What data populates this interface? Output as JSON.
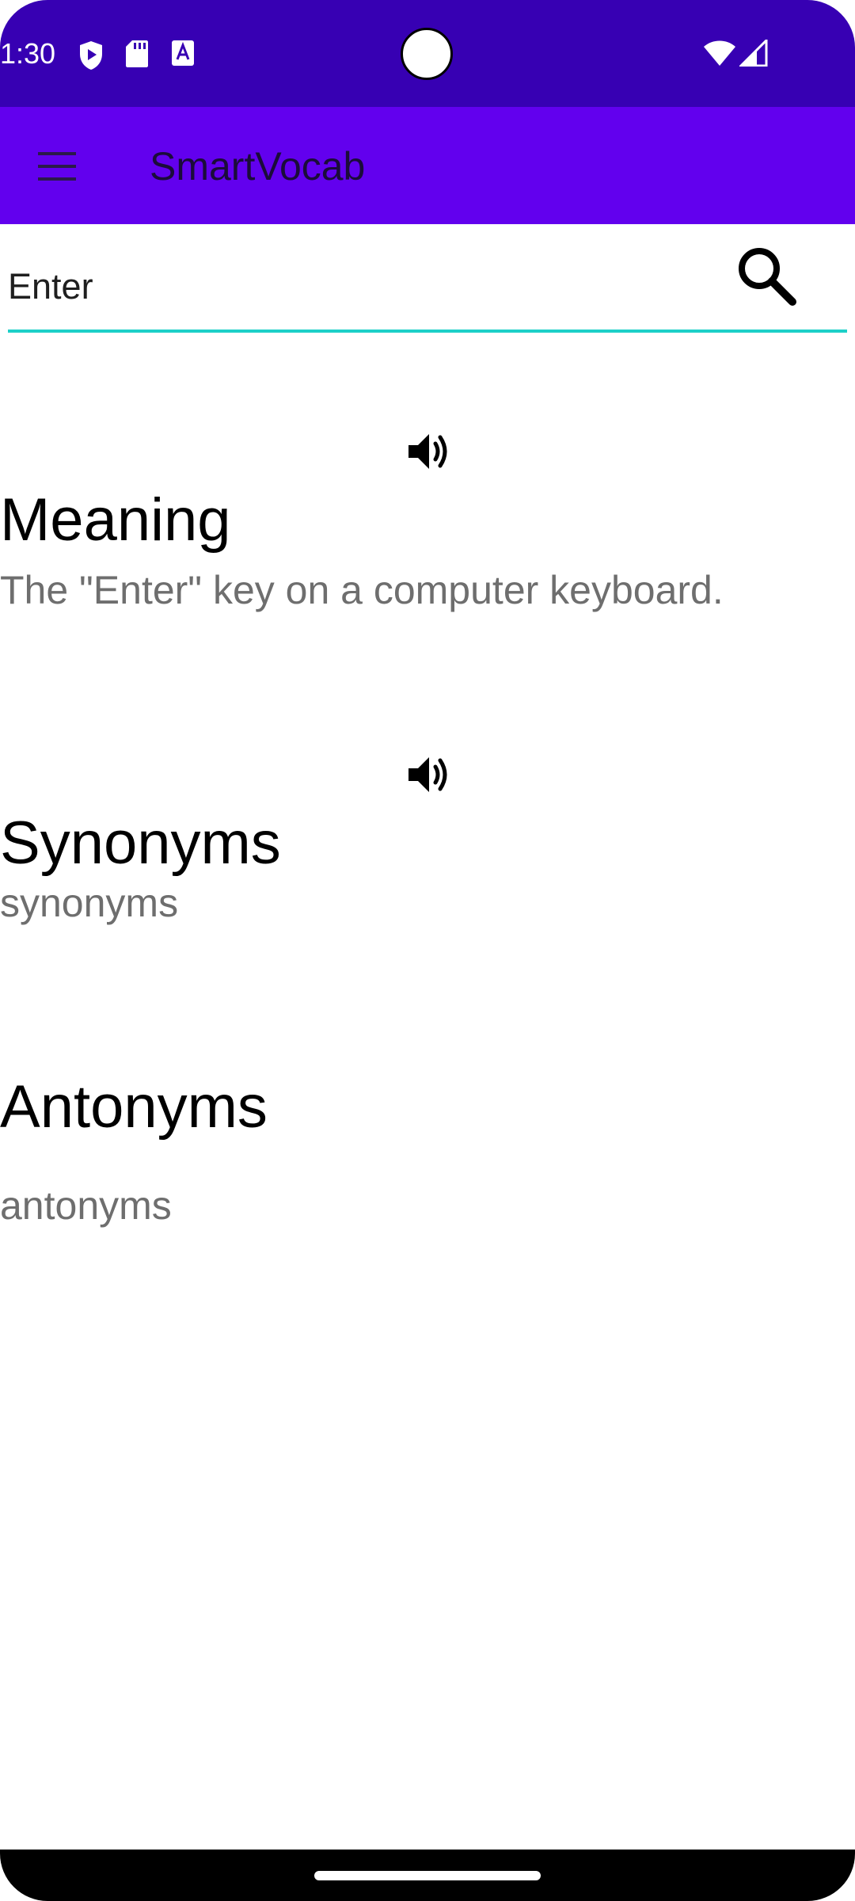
{
  "status_bar": {
    "time": "1:30",
    "icons": [
      "play-protect-icon",
      "sd-card-icon",
      "font-icon",
      "wifi-icon",
      "signal-icon"
    ]
  },
  "toolbar": {
    "title": "SmartVocab",
    "background": "#6200EE",
    "menu_icon": "hamburger-menu-icon"
  },
  "search": {
    "value": "Enter",
    "accent": "#1DD0C8",
    "icon": "search-icon"
  },
  "sections": {
    "meaning": {
      "title": "Meaning",
      "body": "The \"Enter\" key on a computer keyboard.",
      "icon": "speaker-icon"
    },
    "synonyms": {
      "title": "Synonyms",
      "body": "synonyms",
      "icon": "speaker-icon"
    },
    "antonyms": {
      "title": "Antonyms",
      "body": "antonyms"
    }
  }
}
